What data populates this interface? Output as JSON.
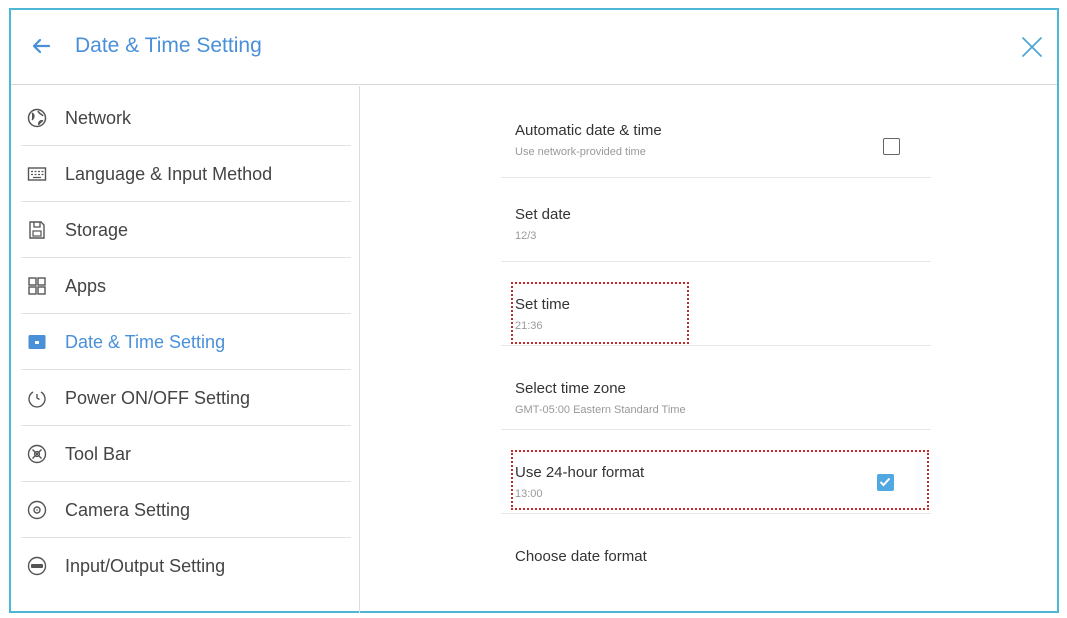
{
  "header": {
    "title": "Date & Time Setting",
    "back_icon": "arrow-left-icon",
    "close_icon": "close-icon",
    "accent_color": "#4a90d9",
    "frame_color": "#4fb7d6"
  },
  "sidebar": {
    "items": [
      {
        "label": "Network",
        "icon": "globe-icon",
        "active": false
      },
      {
        "label": "Language & Input Method",
        "icon": "keyboard-icon",
        "active": false
      },
      {
        "label": "Storage",
        "icon": "storage-icon",
        "active": false
      },
      {
        "label": "Apps",
        "icon": "apps-grid-icon",
        "active": false
      },
      {
        "label": "Date & Time Setting",
        "icon": "calendar-icon",
        "active": true
      },
      {
        "label": "Power ON/OFF Setting",
        "icon": "power-icon",
        "active": false
      },
      {
        "label": "Tool Bar",
        "icon": "toolbar-icon",
        "active": false
      },
      {
        "label": "Camera Setting",
        "icon": "camera-icon",
        "active": false
      },
      {
        "label": "Input/Output Setting",
        "icon": "input-output-icon",
        "active": false
      }
    ]
  },
  "settings": {
    "automatic": {
      "title": "Automatic date & time",
      "subtitle": "Use network-provided time",
      "checked": false
    },
    "set_date": {
      "title": "Set date",
      "value": "12/3"
    },
    "set_time": {
      "title": "Set time",
      "value": "21:36"
    },
    "time_zone": {
      "title": "Select time zone",
      "value": "GMT-05:00 Eastern Standard Time"
    },
    "hour_format": {
      "title": "Use 24-hour format",
      "value": "13:00",
      "checked": true
    },
    "date_format": {
      "title": "Choose date format"
    }
  },
  "highlight_color": "#c62a2a",
  "check_color": "#4fa8e2"
}
